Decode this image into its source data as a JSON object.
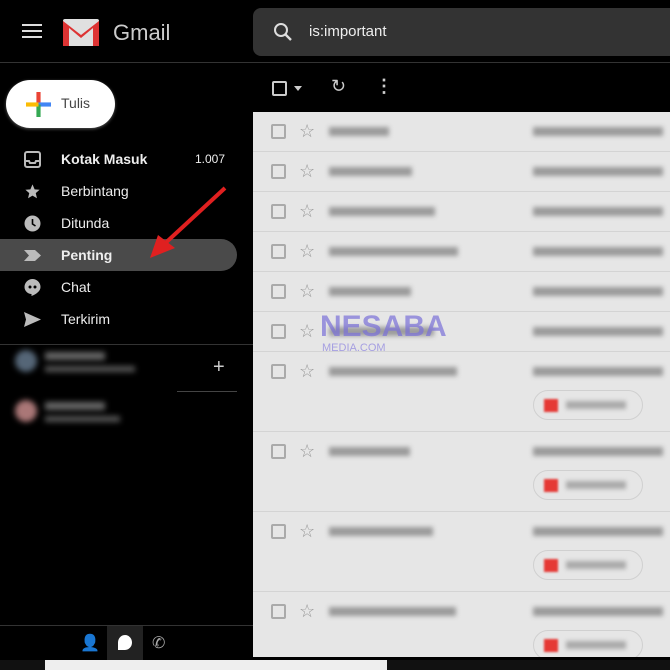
{
  "header": {
    "app_name": "Gmail",
    "search_query": "is:important"
  },
  "compose": {
    "label": "Tulis"
  },
  "nav": [
    {
      "label": "Kotak Masuk",
      "count": "1.007",
      "icon": "inbox-icon",
      "bold": true
    },
    {
      "label": "Berbintang",
      "icon": "star-icon"
    },
    {
      "label": "Ditunda",
      "icon": "clock-icon"
    },
    {
      "label": "Penting",
      "icon": "important-icon",
      "active": true
    },
    {
      "label": "Chat",
      "icon": "chat-icon"
    },
    {
      "label": "Terkirim",
      "icon": "send-icon"
    }
  ],
  "watermark": {
    "line1": "NESABA",
    "line2": "MEDIA.COM"
  },
  "colors": {
    "accent_red": "#e53935",
    "active_nav": "#4a4a4a",
    "list_bg": "#e6e6e6"
  }
}
